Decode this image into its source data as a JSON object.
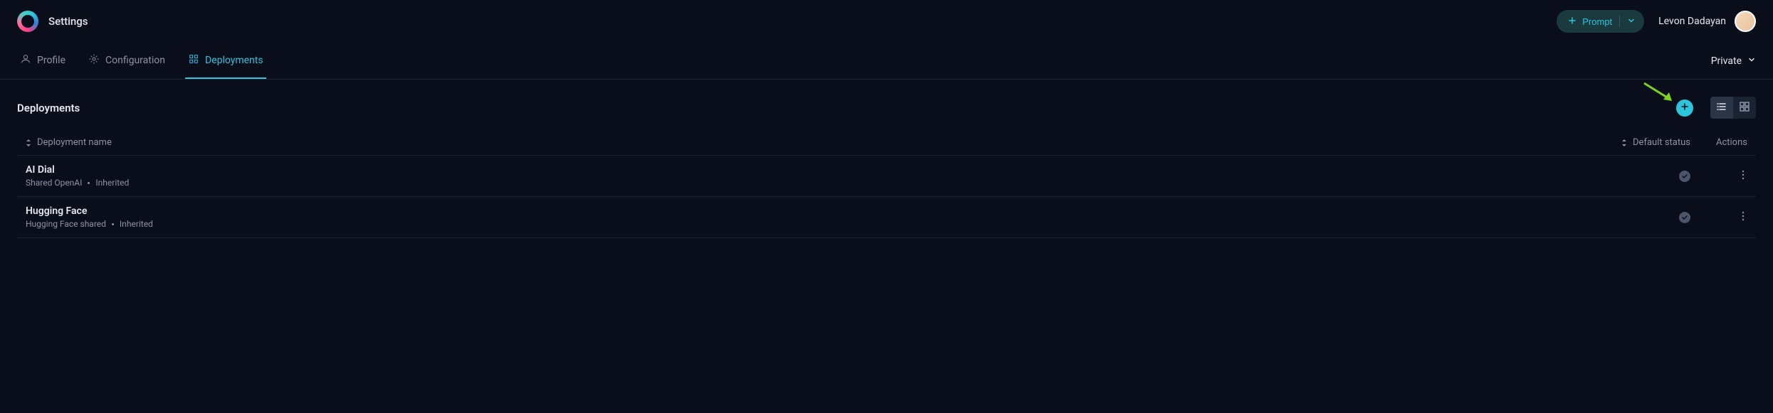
{
  "header": {
    "title": "Settings",
    "prompt_button": "Prompt",
    "user_name": "Levon Dadayan"
  },
  "tabs": {
    "profile": "Profile",
    "configuration": "Configuration",
    "deployments": "Deployments",
    "active": "deployments"
  },
  "visibility": {
    "selected": "Private"
  },
  "section": {
    "title": "Deployments"
  },
  "table": {
    "columns": {
      "name": "Deployment name",
      "status": "Default status",
      "actions": "Actions"
    },
    "rows": [
      {
        "name": "AI Dial",
        "source": "Shared OpenAI",
        "inheritance": "Inherited",
        "status_ok": true
      },
      {
        "name": "Hugging Face",
        "source": "Hugging Face shared",
        "inheritance": "Inherited",
        "status_ok": true
      }
    ]
  },
  "colors": {
    "accent": "#2ec4dc",
    "annotation": "#7ed321"
  }
}
